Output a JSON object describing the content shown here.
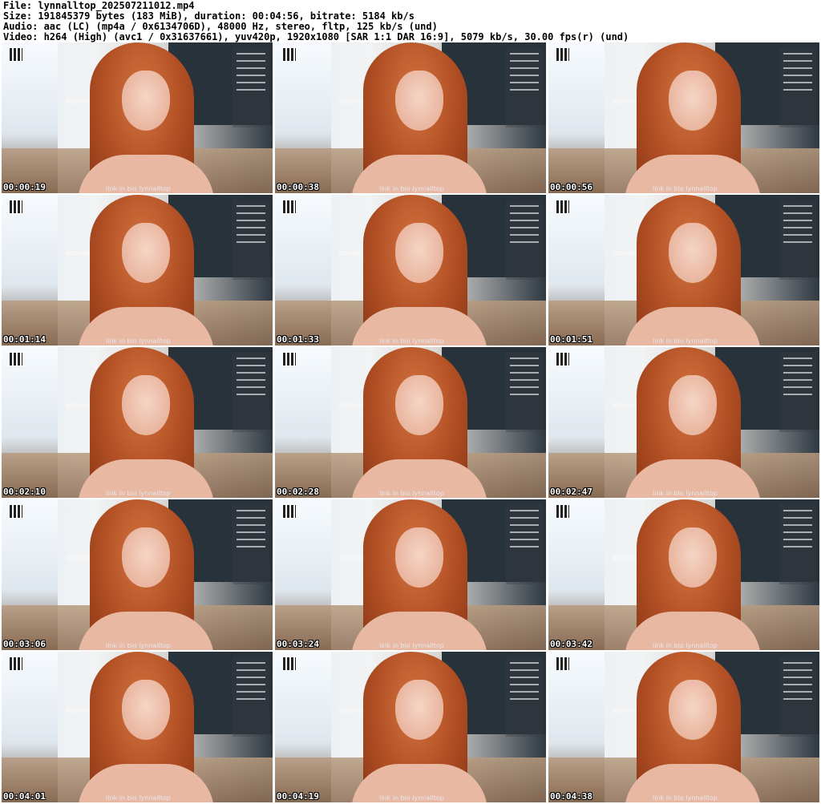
{
  "header": {
    "file": "File: lynnalltop_202507211012.mp4",
    "size": "Size: 191845379 bytes (183 MiB), duration: 00:04:56, bitrate: 5184 kb/s",
    "audio": "Audio: aac (LC) (mp4a / 0x6134706D), 48000 Hz, stereo, fltp, 125 kb/s (und)",
    "video": "Video: h264 (High) (avc1 / 0x31637661), yuv420p, 1920x1080 [SAR 1:1 DAR 16:9], 5079 kb/s, 30.00 fps(r) (und)"
  },
  "thumbnails": [
    {
      "time": "00:00:19"
    },
    {
      "time": "00:00:38"
    },
    {
      "time": "00:00:56"
    },
    {
      "time": "00:01:14"
    },
    {
      "time": "00:01:33"
    },
    {
      "time": "00:01:51"
    },
    {
      "time": "00:02:10"
    },
    {
      "time": "00:02:28"
    },
    {
      "time": "00:02:47"
    },
    {
      "time": "00:03:06"
    },
    {
      "time": "00:03:24"
    },
    {
      "time": "00:03:42"
    },
    {
      "time": "00:04:01"
    },
    {
      "time": "00:04:19"
    },
    {
      "time": "00:04:38"
    }
  ],
  "watermark": "link in bio   lynnalltop"
}
